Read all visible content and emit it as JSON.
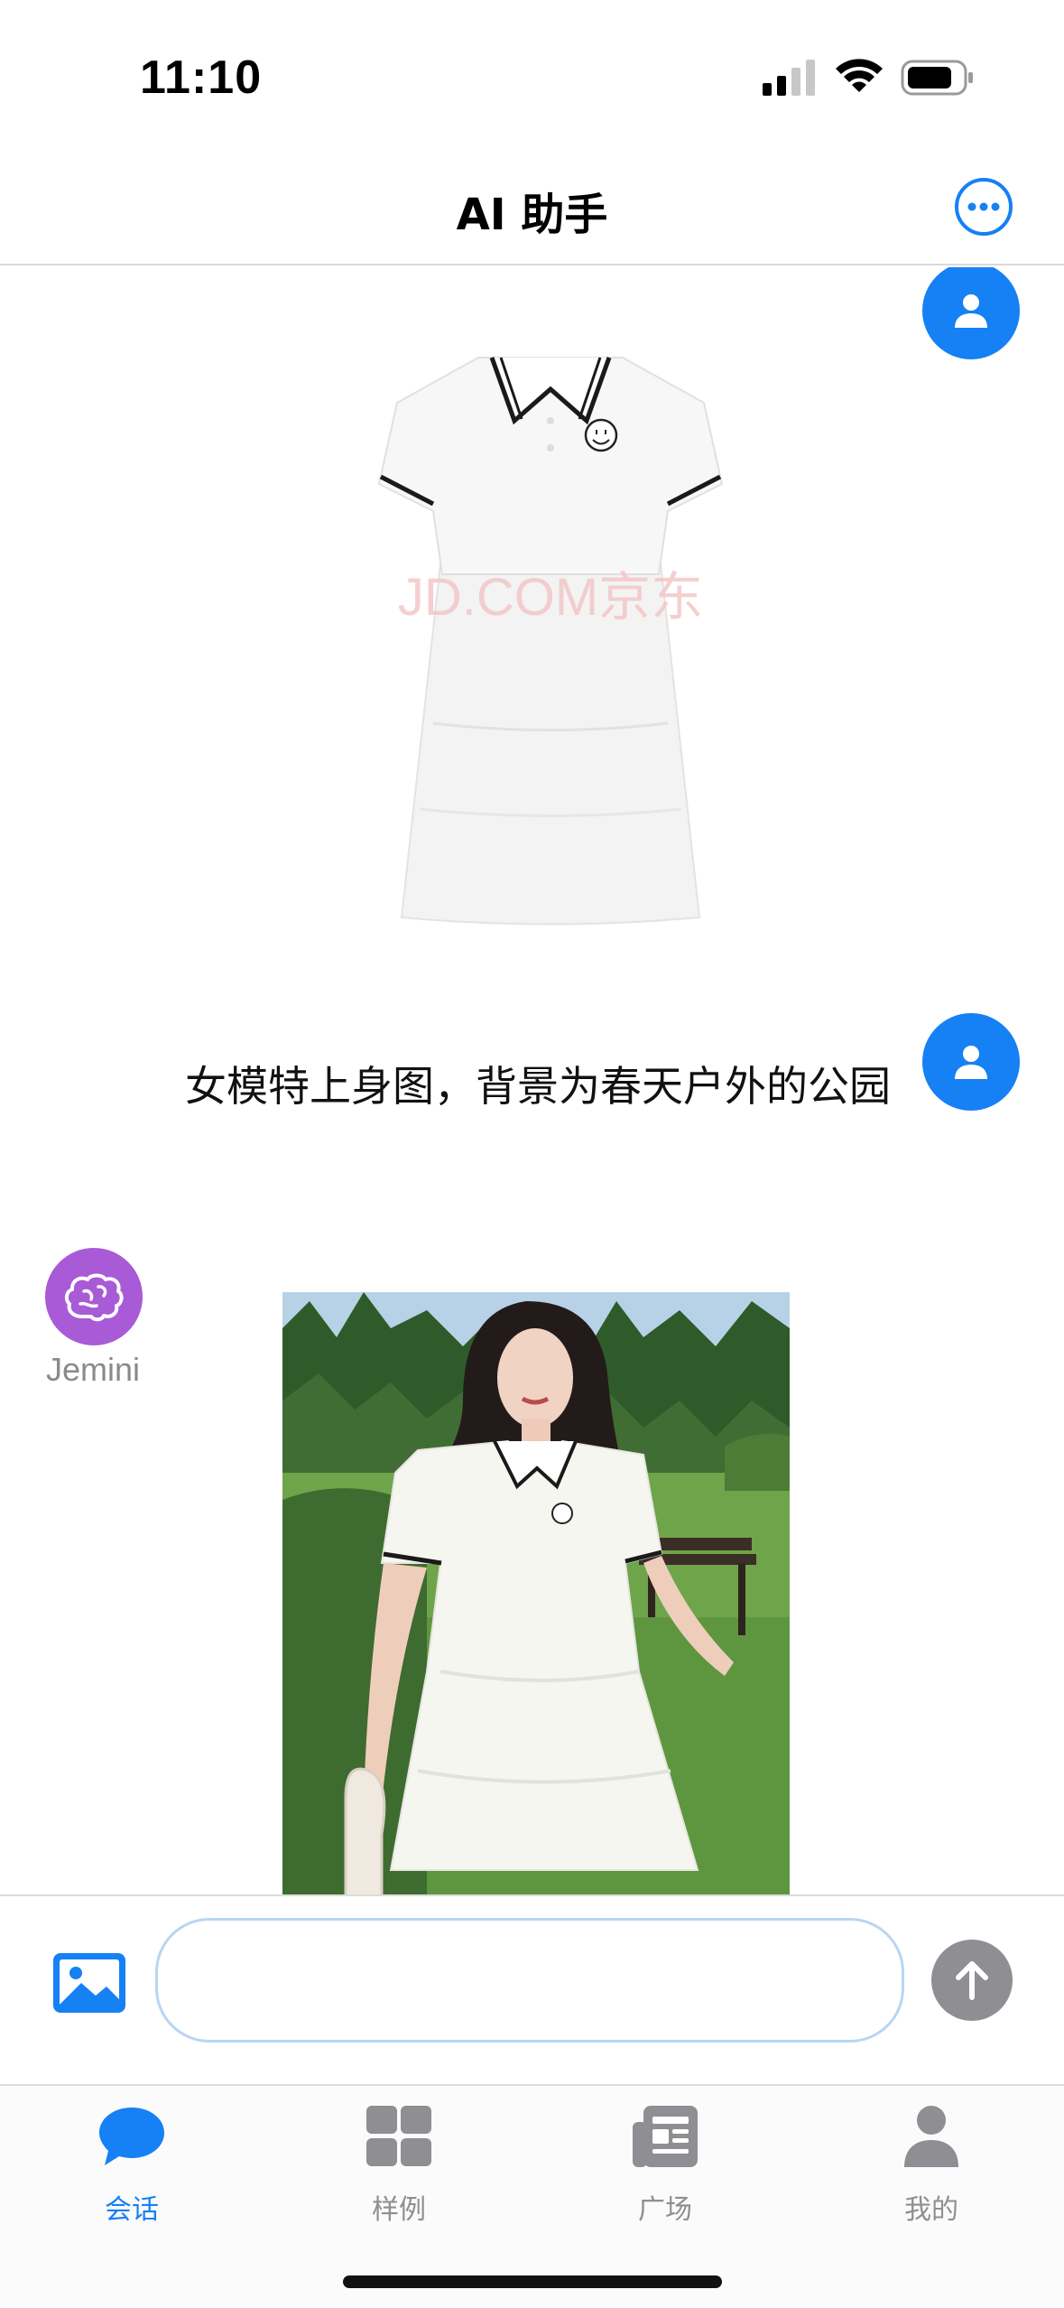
{
  "status_bar": {
    "time": "11:10"
  },
  "header": {
    "title": "AI 助手"
  },
  "chat": {
    "messages": [
      {
        "role": "user",
        "type": "image",
        "watermark": "JD.COM京东"
      },
      {
        "role": "user",
        "type": "text",
        "text": "女模特上身图，背景为春天户外的公园"
      },
      {
        "role": "assistant",
        "type": "image",
        "sender_name": "Jemini"
      }
    ]
  },
  "input": {
    "placeholder": ""
  },
  "tabs": [
    {
      "label": "会话",
      "icon": "chat-bubble-icon",
      "active": true
    },
    {
      "label": "样例",
      "icon": "grid-icon",
      "active": false
    },
    {
      "label": "广场",
      "icon": "newspaper-icon",
      "active": false
    },
    {
      "label": "我的",
      "icon": "person-icon",
      "active": false
    }
  ],
  "colors": {
    "accent": "#1680f5",
    "bot_avatar": "#a95ad6",
    "inactive": "#8e8e93"
  }
}
